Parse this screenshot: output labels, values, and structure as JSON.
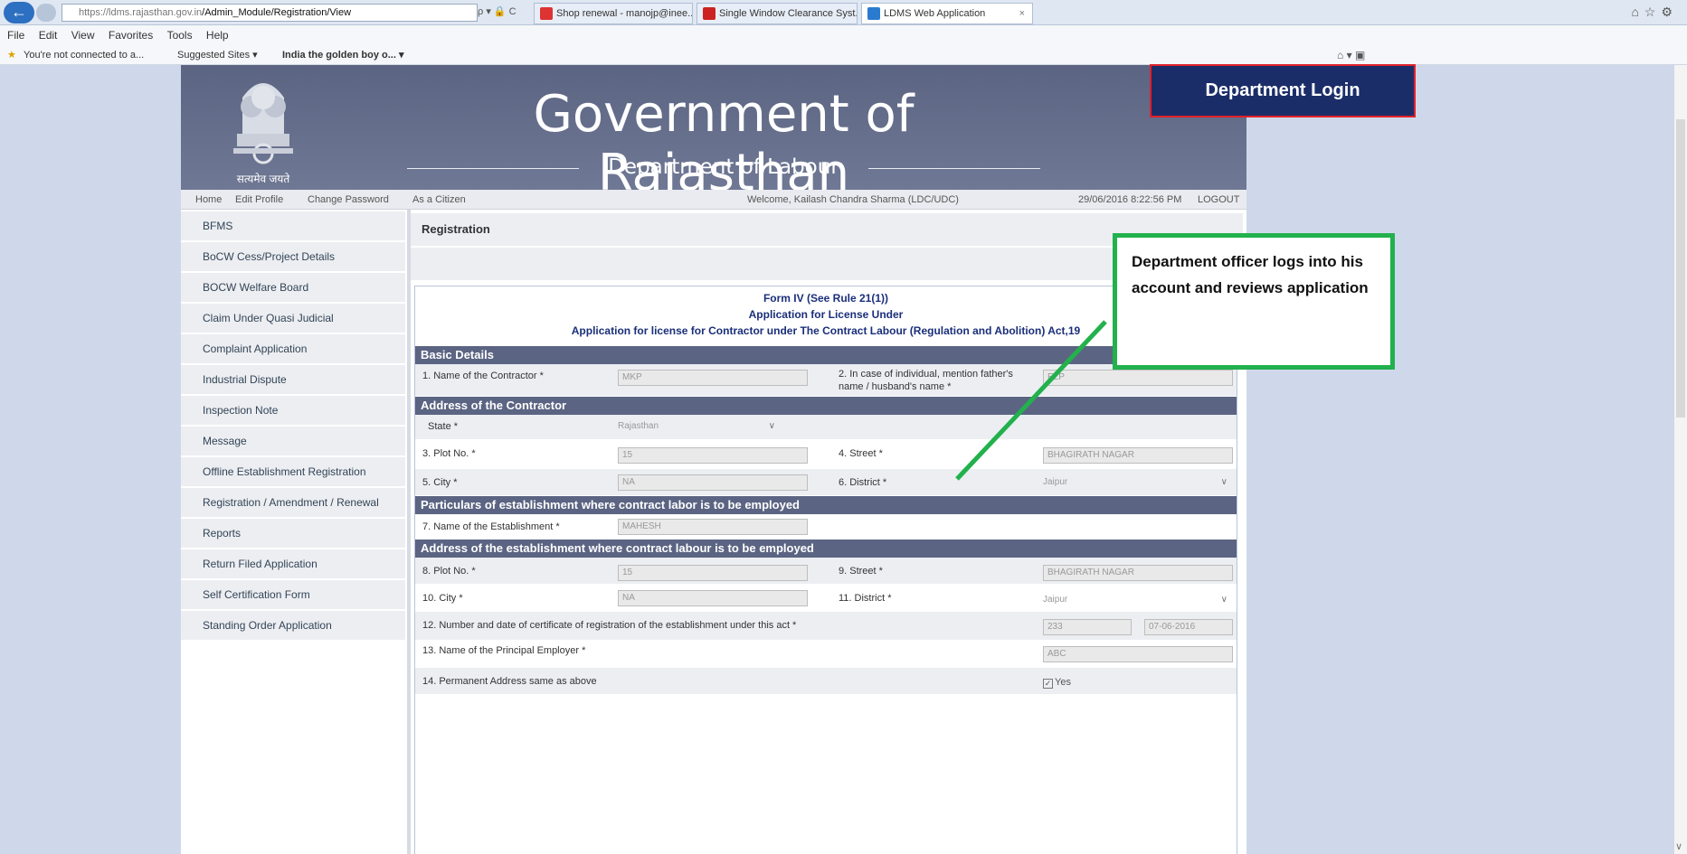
{
  "browser": {
    "url_host": "https://ldms.rajasthan.gov.in",
    "url_path": "/Admin_Module/Registration/View",
    "url_controls": "ρ ▾ 🔒 C",
    "tabs": [
      {
        "label": "Shop renewal - manojp@inee...",
        "color": "#d33"
      },
      {
        "label": "Single Window Clearance Syst...",
        "color": "#c22"
      },
      {
        "label": "LDMS Web Application",
        "color": "#2a7bd0"
      }
    ],
    "tab_close": "×",
    "menu": [
      "File",
      "Edit",
      "View",
      "Favorites",
      "Tools",
      "Help"
    ],
    "favorites": [
      "You're not connected to a...",
      "Suggested Sites ▾",
      "India the golden boy o... ▾"
    ]
  },
  "header": {
    "title": "Government of Rajasthan",
    "department": "Department of Labour",
    "emblem_motto": "सत्यमेव जयते"
  },
  "topnav": {
    "home": "Home",
    "edit_profile": "Edit Profile",
    "change_password": "Change Password",
    "as_citizen": "As a Citizen",
    "welcome": "Welcome, Kailash Chandra Sharma (LDC/UDC)",
    "datetime": "29/06/2016 8:22:56 PM",
    "logout": "LOGOUT"
  },
  "sidebar": {
    "items": [
      "BFMS",
      "BoCW Cess/Project Details",
      "BOCW Welfare Board",
      "Claim Under Quasi Judicial",
      "Complaint Application",
      "Industrial Dispute",
      "Inspection Note",
      "Message",
      "Offline Establishment Registration",
      "Registration / Amendment / Renewal",
      "Reports",
      "Return Filed Application",
      "Self Certification Form",
      "Standing Order Application"
    ]
  },
  "main": {
    "heading": "Registration",
    "form_title_1": "Form IV (See Rule 21(1))",
    "form_title_2": "Application for License Under",
    "form_title_3": "Application for license for Contractor under The Contract Labour (Regulation and Abolition) Act,19",
    "sections": {
      "basic": "Basic Details",
      "contractor_address": "Address of the Contractor",
      "particulars": "Particulars of establishment where contract labor is to be employed",
      "establishment_address": "Address of the establishment where contract labour is to be employed"
    },
    "fields": {
      "contractor_name_label": "1. Name of the Contractor *",
      "contractor_name": "MKP",
      "father_name_label": "2. In case of individual, mention father's name / husband's name *",
      "father_name": "ELP",
      "state_label": "State *",
      "state": "Rajasthan",
      "plot_label": "3. Plot No. *",
      "plot": "15",
      "street_label": "4. Street *",
      "street": "BHAGIRATH NAGAR",
      "city_label": "5. City *",
      "city": "NA",
      "district_label": "6. District *",
      "district": "Jaipur",
      "est_name_label": "7. Name of the Establishment *",
      "est_name": "MAHESH",
      "est_plot_label": "8. Plot No. *",
      "est_plot": "15",
      "est_street_label": "9. Street *",
      "est_street": "BHAGIRATH NAGAR",
      "est_city_label": "10. City *",
      "est_city": "NA",
      "est_district_label": "11. District *",
      "est_district": "Jaipur",
      "cert_label": "12. Number and date of certificate of registration of the establishment under this act *",
      "cert_number": "233",
      "cert_date": "07-06-2016",
      "employer_label": "13. Name of the Principal Employer *",
      "employer": "ABC",
      "perm_addr_label": "14. Permanent Address same as above",
      "perm_addr_yes": "Yes"
    }
  },
  "annotations": {
    "login": "Department Login",
    "review": "Department officer logs into his account and reviews application"
  },
  "colors": {
    "banner": "#5b6482",
    "callout_login_bg": "#1b2d69",
    "callout_login_border": "#e0202a",
    "callout_review_border": "#22b14c"
  }
}
